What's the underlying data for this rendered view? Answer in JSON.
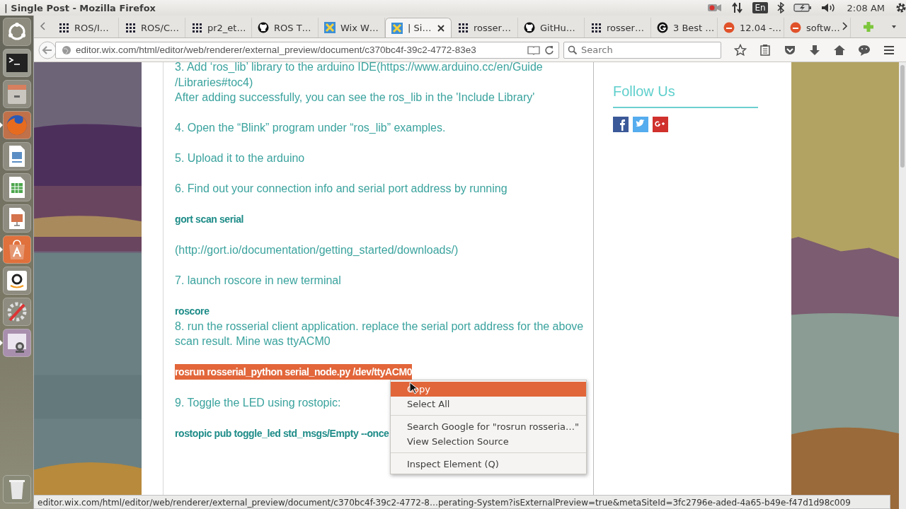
{
  "top_panel": {
    "window_title": "| Single Post - Mozilla Firefox",
    "indicators": [
      {
        "kind": "record"
      },
      {
        "kind": "network"
      },
      {
        "kind": "keyboard",
        "label": "En"
      },
      {
        "kind": "bluetooth"
      },
      {
        "kind": "battery"
      },
      {
        "kind": "volume"
      },
      {
        "kind": "clock",
        "label": "2:08 AM"
      },
      {
        "kind": "settings"
      }
    ]
  },
  "launcher": [
    {
      "kind": "dash",
      "running": false
    },
    {
      "kind": "terminal",
      "running": false
    },
    {
      "kind": "files",
      "running": false
    },
    {
      "kind": "firefox",
      "running": true
    },
    {
      "kind": "writer",
      "running": false
    },
    {
      "kind": "calc",
      "running": false
    },
    {
      "kind": "impress",
      "running": false
    },
    {
      "kind": "software",
      "running": true
    },
    {
      "kind": "amazon",
      "running": false
    },
    {
      "kind": "settings",
      "running": false
    },
    {
      "kind": "webcam",
      "running": true
    },
    {
      "kind": "trash",
      "running": false
    }
  ],
  "tabs": [
    {
      "label": "ROS/I…",
      "kind": "grid",
      "selected": false
    },
    {
      "label": "ROS/C…",
      "kind": "grid",
      "selected": false
    },
    {
      "label": "pr2_et…",
      "kind": "grid",
      "selected": false
    },
    {
      "label": "ROS T…",
      "kind": "github",
      "selected": false
    },
    {
      "label": "Wix W…",
      "kind": "wix",
      "selected": false
    },
    {
      "label": "| Si…",
      "kind": "wix",
      "selected": true
    },
    {
      "label": "rosser…",
      "kind": "grid",
      "selected": false
    },
    {
      "label": "GitHu…",
      "kind": "github",
      "selected": false
    },
    {
      "label": "rosser…",
      "kind": "grid",
      "selected": false
    },
    {
      "label": "3 Best …",
      "kind": "g",
      "selected": false
    },
    {
      "label": "12.04 -…",
      "kind": "ask",
      "selected": false
    },
    {
      "label": "softw…",
      "kind": "ask",
      "selected": false
    }
  ],
  "toolbar": {
    "url": "editor.wix.com/html/editor/web/renderer/external_preview/document/c370bc4f-39c2-4772-83e3",
    "search_placeholder": "Search"
  },
  "post": {
    "blocks": [
      {
        "lines": [
          {
            "kind": "text",
            "selected": false,
            "text": "3. Add ‘ros_lib’ library to the arduino IDE(https://www.arduino.cc/en/Guide"
          },
          {
            "kind": "text",
            "selected": false,
            "text": "/Libraries#toc4)"
          },
          {
            "kind": "text",
            "selected": false,
            "text": "After adding successfully, you can see the ros_lib in the 'Include Library'"
          }
        ]
      },
      {
        "lines": [
          {
            "kind": "text",
            "selected": false,
            "text": "4. Open the “Blink” program under “ros_lib” examples."
          }
        ]
      },
      {
        "lines": [
          {
            "kind": "text",
            "selected": false,
            "text": "5. Upload it to the arduino"
          }
        ]
      },
      {
        "lines": [
          {
            "kind": "text",
            "selected": false,
            "text": "6. Find out your connection info and serial port address by running"
          }
        ]
      },
      {
        "lines": [
          {
            "kind": "code",
            "selected": false,
            "text": "gort scan serial"
          }
        ]
      },
      {
        "lines": [
          {
            "kind": "text",
            "selected": false,
            "text": "(http://gort.io/documentation/getting_started/downloads/)"
          }
        ]
      },
      {
        "lines": [
          {
            "kind": "text",
            "selected": false,
            "text": "7. launch roscore in new terminal"
          }
        ]
      },
      {
        "lines": [
          {
            "kind": "code",
            "selected": false,
            "text": "roscore"
          },
          {
            "kind": "text",
            "selected": false,
            "text": "8. run the rosserial client application. replace the serial port address for the above"
          },
          {
            "kind": "text",
            "selected": false,
            "text": "scan result. Mine was ttyACM0"
          }
        ]
      },
      {
        "lines": [
          {
            "kind": "code",
            "selected": true,
            "text": "rosrun rosserial_python serial_node.py /dev/ttyACM0"
          }
        ]
      },
      {
        "lines": [
          {
            "kind": "text",
            "selected": false,
            "text": "9.  Toggle the LED using rostopic:"
          }
        ]
      },
      {
        "lines": [
          {
            "kind": "code",
            "selected": false,
            "text": "rostopic pub toggle_led std_msgs/Empty --once"
          }
        ]
      }
    ]
  },
  "sidebar": {
    "heading": "Follow Us",
    "social": [
      {
        "kind": "facebook",
        "color": "#3b5998"
      },
      {
        "kind": "twitter",
        "color": "#55acee"
      },
      {
        "kind": "googleplus",
        "color": "#d0312d"
      }
    ]
  },
  "context_menu": {
    "groups": [
      {
        "items": [
          {
            "label": "Copy",
            "selected": true
          },
          {
            "label": "Select All",
            "selected": false
          }
        ]
      },
      {
        "items": [
          {
            "label": "Search Google for \"rosrun rosseria…\"",
            "selected": false
          },
          {
            "label": "View Selection Source",
            "selected": false
          }
        ]
      },
      {
        "items": [
          {
            "label": "Inspect Element (Q)",
            "selected": false
          }
        ]
      }
    ]
  },
  "status_bar": {
    "text": "editor.wix.com/html/editor/web/renderer/external_preview/document/c370bc4f-39c2-4772-8…perating-System?isExternalPreview=true&metaSiteId=3fc2796e-aded-4a65-b49e-f47d1d98c009"
  }
}
